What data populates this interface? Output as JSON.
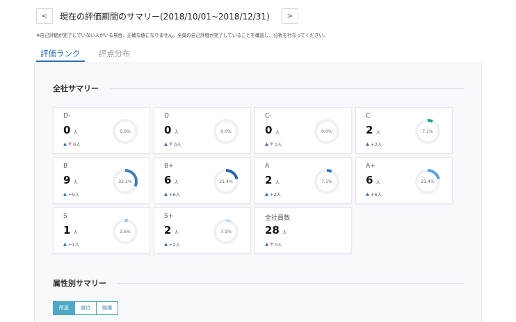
{
  "header": {
    "prev_label": "<",
    "next_label": ">",
    "title": "現在の評価期間のサマリー(2018/10/01~2018/12/31)"
  },
  "notice": "※自己評価が完了していない人がいる場合、正確な値になりません。全員の自己評価が完了していることを確認し、分析を行なってください。",
  "tabs": [
    {
      "label": "評価ランク",
      "active": true
    },
    {
      "label": "評点分布",
      "active": false
    }
  ],
  "company_summary": {
    "title": "全社サマリー",
    "unit": "人",
    "cards": [
      {
        "label": "D-",
        "count": "0",
        "delta": "0人",
        "arrows": "both",
        "percent": "0.0%",
        "share": 0.0
      },
      {
        "label": "D",
        "count": "0",
        "delta": "0人",
        "arrows": "both",
        "percent": "0.0%",
        "share": 0.0
      },
      {
        "label": "C-",
        "count": "0",
        "delta": "0人",
        "arrows": "both",
        "percent": "0.0%",
        "share": 0.0
      },
      {
        "label": "C",
        "count": "2",
        "delta": "+2人",
        "arrows": "up",
        "percent": "7.1%",
        "share": 0.071
      },
      {
        "label": "B",
        "count": "9",
        "delta": "+9人",
        "arrows": "up",
        "percent": "32.1%",
        "share": 0.321
      },
      {
        "label": "B+",
        "count": "6",
        "delta": "+6人",
        "arrows": "up",
        "percent": "21.4%",
        "share": 0.214
      },
      {
        "label": "A",
        "count": "2",
        "delta": "+2人",
        "arrows": "up",
        "percent": "7.1%",
        "share": 0.071
      },
      {
        "label": "A+",
        "count": "6",
        "delta": "+6人",
        "arrows": "up",
        "percent": "21.4%",
        "share": 0.214
      },
      {
        "label": "S",
        "count": "1",
        "delta": "+1人",
        "arrows": "up",
        "percent": "3.6%",
        "share": 0.036
      },
      {
        "label": "S+",
        "count": "2",
        "delta": "+2人",
        "arrows": "up",
        "percent": "7.1%",
        "share": 0.071
      }
    ],
    "total": {
      "label": "全社員数",
      "count": "28",
      "delta": "0人",
      "arrows": "both"
    }
  },
  "attribute_summary": {
    "title": "属性別サマリー",
    "filters": [
      {
        "label": "所属",
        "active": true
      },
      {
        "label": "職位",
        "active": false
      },
      {
        "label": "職種",
        "active": false
      }
    ]
  },
  "colors": {
    "accent": "#2f6fb3",
    "up": "#2f6fb3",
    "down": "#e58a9a",
    "ring_track": "#eef1f5",
    "ring_D-": "#cccccc",
    "ring_D": "#cccccc",
    "ring_C-": "#cccccc",
    "ring_C": "#1f9e89",
    "ring_B": "#3f7fb5",
    "ring_B+": "#2863ad",
    "ring_A": "#2d7fd6",
    "ring_A+": "#5aa3e0",
    "ring_S": "#8fc3ec",
    "ring_S+": "#c6e0f5"
  },
  "icons": {
    "up": "triangle-up-icon",
    "down": "triangle-down-icon"
  }
}
